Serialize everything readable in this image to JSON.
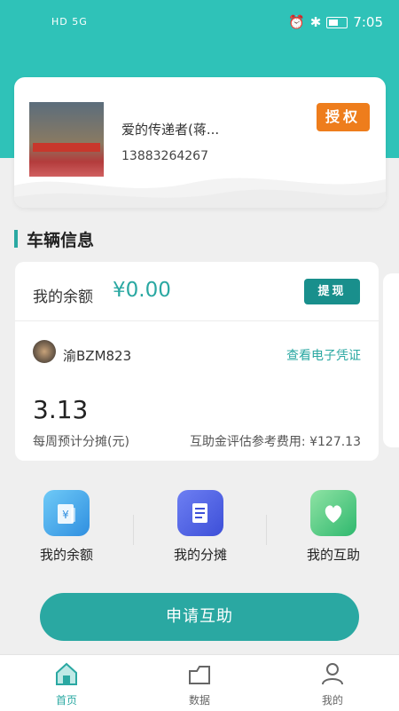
{
  "status_bar": {
    "left": "HD 5G",
    "time": "7:05"
  },
  "profile": {
    "name": "爱的传递者(蒋...",
    "phone": "13883264267",
    "auth_button": "授权"
  },
  "section": {
    "title": "车辆信息"
  },
  "vehicle_card": {
    "balance_label": "我的余额",
    "balance_value": "¥0.00",
    "withdraw_button": "提现",
    "plate": "渝BZM823",
    "voucher_link": "查看电子凭证",
    "weekly_amount": "3.13",
    "weekly_label": "每周预计分摊(元)",
    "fee_text": "互助金评估参考费用: ¥127.13"
  },
  "menu": {
    "items": [
      {
        "label": "我的余额",
        "icon": "wallet-icon"
      },
      {
        "label": "我的分摊",
        "icon": "document-icon"
      },
      {
        "label": "我的互助",
        "icon": "heart-icon"
      }
    ]
  },
  "apply_button": "申请互助",
  "tabbar": {
    "items": [
      {
        "label": "首页",
        "icon": "home-icon",
        "active": true
      },
      {
        "label": "数据",
        "icon": "data-icon",
        "active": false
      },
      {
        "label": "我的",
        "icon": "user-icon",
        "active": false
      }
    ]
  },
  "colors": {
    "primary": "#2aa8a2",
    "header": "#2fc2b8",
    "auth": "#ee7d1c"
  }
}
